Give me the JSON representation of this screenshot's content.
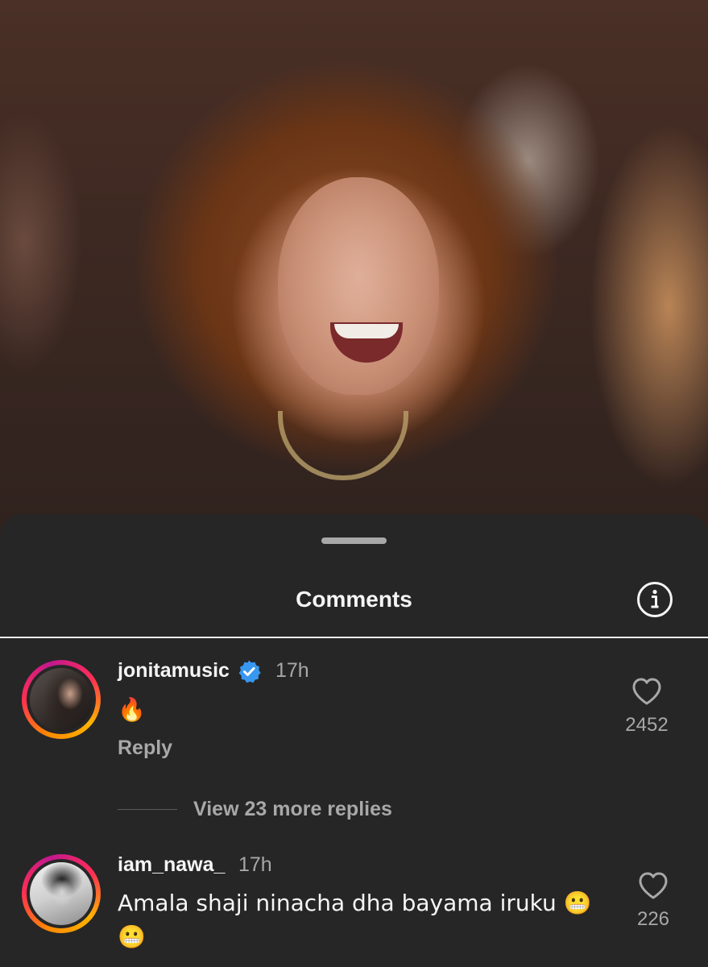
{
  "sheet": {
    "title": "Comments",
    "info_icon": "info-icon"
  },
  "comments": [
    {
      "username": "jonitamusic",
      "verified": true,
      "time": "17h",
      "text": "🔥",
      "reply_label": "Reply",
      "likes": "2452",
      "view_replies": "View 23 more replies"
    },
    {
      "username": "iam_nawa_",
      "verified": false,
      "time": "17h",
      "text": "Amala shaji ninacha dha bayama iruku 😬\n😬",
      "likes": "226"
    }
  ],
  "colors": {
    "sheet_bg": "#262626",
    "text_primary": "#f5f5f5",
    "text_secondary": "#a8a8a8",
    "verified_blue": "#3897f0"
  }
}
